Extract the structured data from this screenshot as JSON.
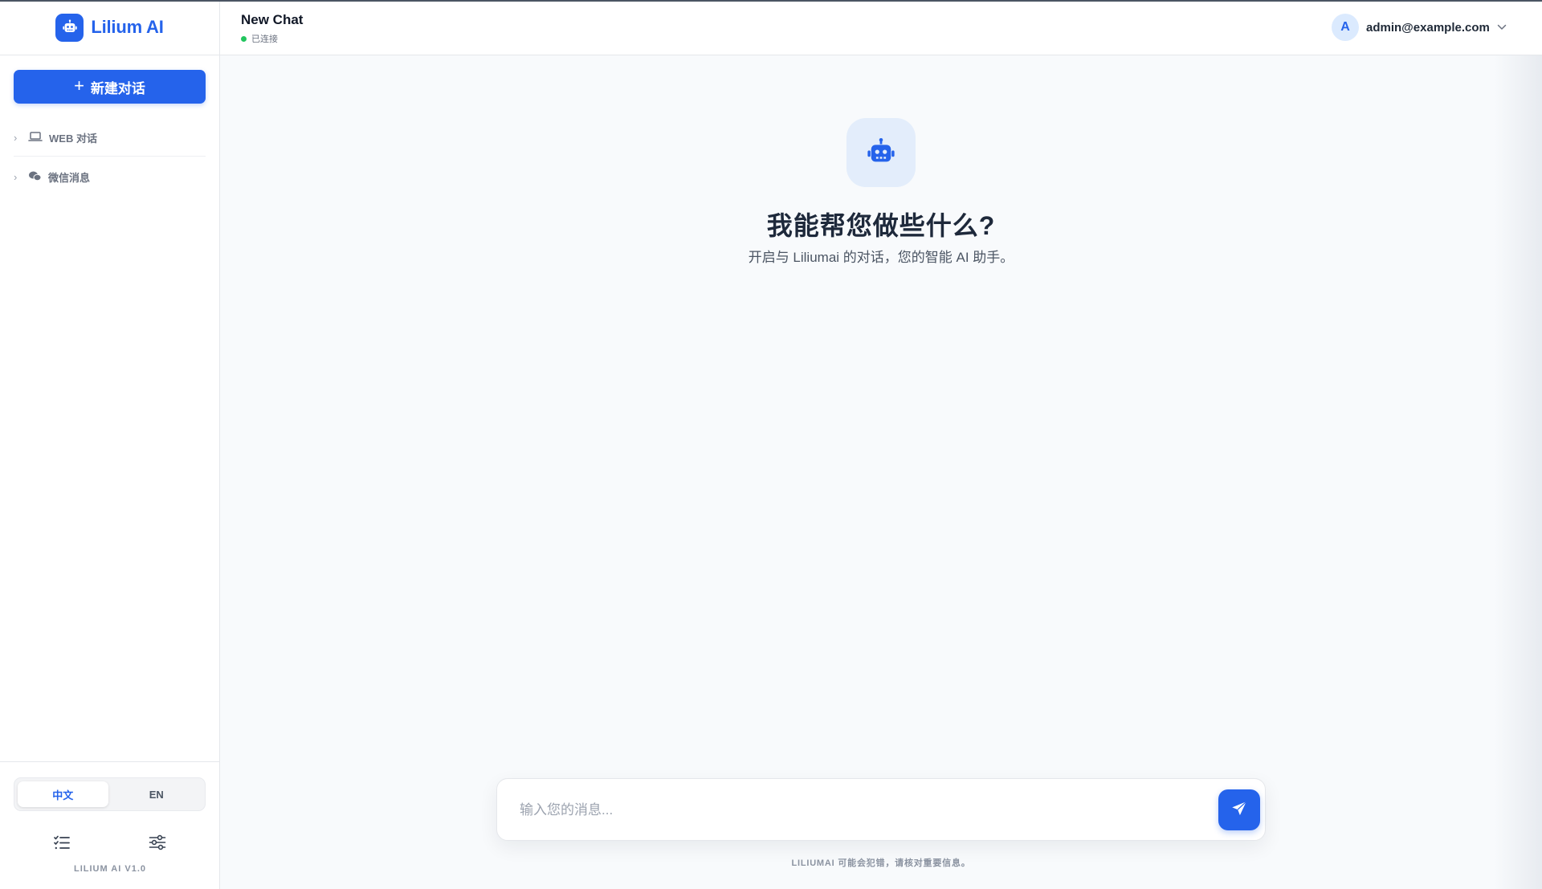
{
  "brand": {
    "name": "Lilium AI",
    "icon": "robot-icon",
    "accent": "#2563eb"
  },
  "sidebar": {
    "new_chat_label": "新建对话",
    "groups": [
      {
        "label": "WEB 对话",
        "icon": "laptop-icon"
      },
      {
        "label": "微信消息",
        "icon": "wechat-icon"
      }
    ],
    "language": {
      "options": [
        "中文",
        "EN"
      ],
      "selected": "中文"
    },
    "tools": [
      {
        "icon": "task-list-icon"
      },
      {
        "icon": "sliders-icon"
      }
    ],
    "version": "LILIUM AI V1.0"
  },
  "header": {
    "title": "New Chat",
    "status": "已连接",
    "status_color": "#22c55e",
    "user": {
      "avatar_letter": "A",
      "email": "admin@example.com"
    }
  },
  "main": {
    "hero_title": "我能帮您做些什么?",
    "hero_subtitle": "开启与 Liliumai 的对话，您的智能 AI 助手。",
    "input_placeholder": "输入您的消息...",
    "disclaimer": "LILIUMAI 可能会犯错，请核对重要信息。"
  }
}
